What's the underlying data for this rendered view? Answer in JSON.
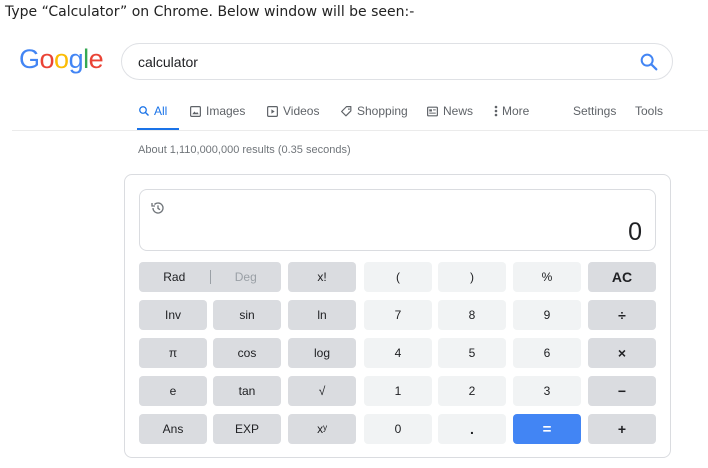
{
  "caption": "Type “Calculator” on Chrome. Below window will be seen:-",
  "logo": {
    "letters": [
      "G",
      "o",
      "o",
      "g",
      "l",
      "e"
    ],
    "colors": [
      "#4285f4",
      "#ea4335",
      "#fbbc05",
      "#4285f4",
      "#34a853",
      "#ea4335"
    ]
  },
  "search": {
    "query": "calculator",
    "icon": "search-icon"
  },
  "tabs": [
    {
      "label": "All",
      "icon": "search-icon",
      "active": true
    },
    {
      "label": "Images",
      "icon": "image-icon"
    },
    {
      "label": "Videos",
      "icon": "play-icon"
    },
    {
      "label": "Shopping",
      "icon": "tag-icon"
    },
    {
      "label": "News",
      "icon": "newspaper-icon"
    },
    {
      "label": "More",
      "icon": "more-vertical-icon"
    },
    {
      "label": "Settings"
    },
    {
      "label": "Tools"
    }
  ],
  "stats": "About 1,110,000,000 results (0.35 seconds)",
  "calculator": {
    "display": "0",
    "history_icon": "history-icon",
    "accent": "#4285f4",
    "rows": [
      [
        "Rad|Deg",
        "x!",
        "(",
        ")",
        "%",
        "AC"
      ],
      [
        "Inv",
        "sin",
        "ln",
        "7",
        "8",
        "9",
        "÷"
      ],
      [
        "π",
        "cos",
        "log",
        "4",
        "5",
        "6",
        "×"
      ],
      [
        "e",
        "tan",
        "√",
        "1",
        "2",
        "3",
        "−"
      ],
      [
        "Ans",
        "EXP",
        "xʸ",
        "0",
        ".",
        "=",
        "+"
      ]
    ],
    "rad_label": "Rad",
    "deg_label": "Deg"
  }
}
